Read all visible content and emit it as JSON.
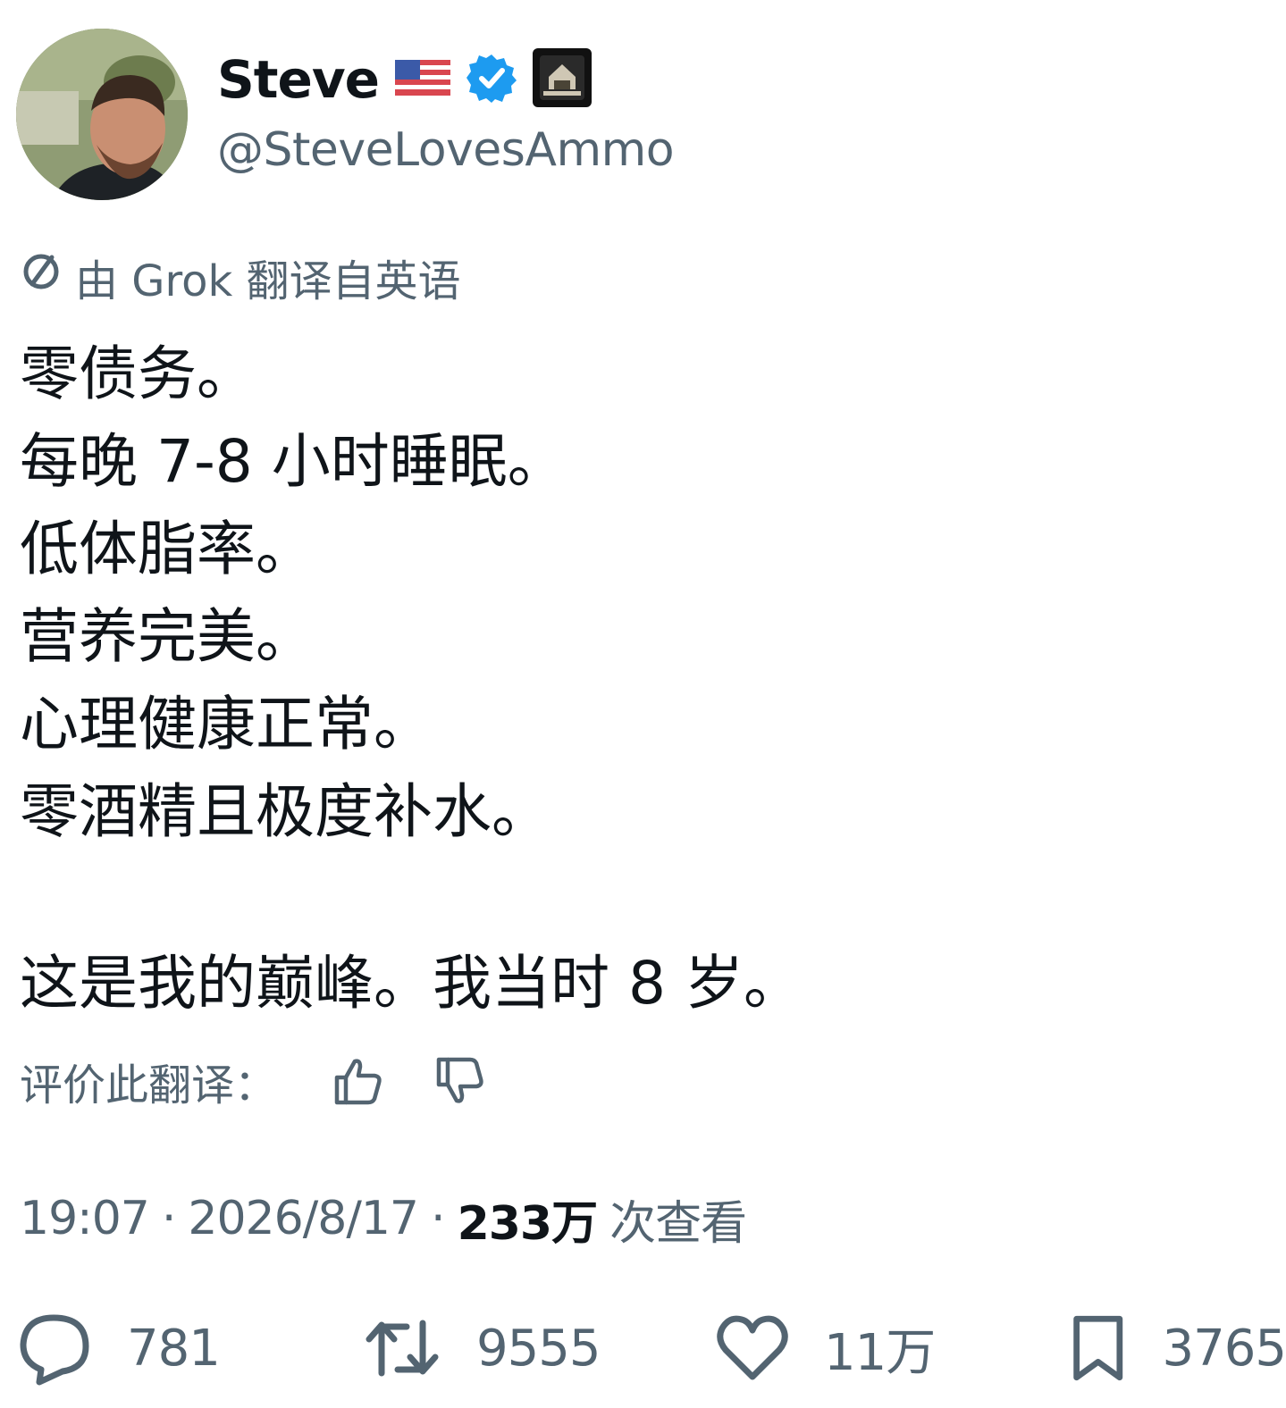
{
  "author": {
    "display_name": "Steve",
    "handle": "@SteveLovesAmmo",
    "badges": [
      "us-flag-icon",
      "verified-badge-icon",
      "affiliate-badge-icon"
    ],
    "verified_color": "#1d9bf0"
  },
  "translation": {
    "note": "由 Grok 翻译自英语",
    "rate_label": "评价此翻译："
  },
  "tweet": {
    "lines": [
      "零债务。",
      "每晚 7-8 小时睡眠。",
      "低体脂率。",
      "营养完美。",
      "心理健康正常。",
      "零酒精且极度补水。"
    ],
    "last_line": "这是我的巅峰。我当时 8 岁。"
  },
  "meta": {
    "time": "19:07",
    "date": "2026/8/17",
    "views_count": "233万",
    "views_label": "次查看"
  },
  "actions": {
    "reply_count": "781",
    "retweet_count": "9555",
    "like_count": "11万",
    "bookmark_count": "3765"
  },
  "colors": {
    "text_primary": "#0f1419",
    "text_secondary": "#536471",
    "accent": "#1d9bf0"
  }
}
